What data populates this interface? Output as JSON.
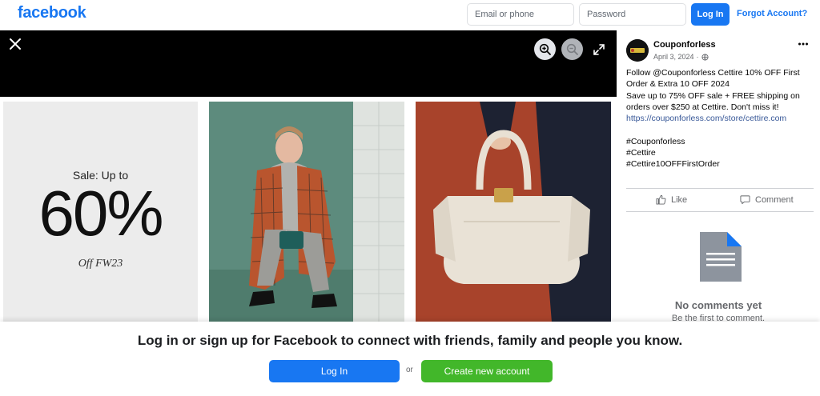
{
  "header": {
    "logo": "facebook",
    "email_placeholder": "Email or phone",
    "password_placeholder": "Password",
    "login_label": "Log In",
    "forgot_label": "Forgot Account?"
  },
  "viewer": {
    "close_icon": "close-icon",
    "zoom_in_icon": "zoom-in-icon",
    "zoom_out_icon": "zoom-out-icon",
    "fullscreen_icon": "fullscreen-icon",
    "tiles": [
      {
        "sale_label": "Sale: Up to",
        "sale_value": "60%",
        "sale_sub": "Off FW23"
      },
      {
        "image": "model-in-checked-coat"
      },
      {
        "image": "beige-handbag"
      }
    ]
  },
  "post": {
    "page_name": "Couponforless",
    "date": "April 3, 2024",
    "date_separator": "·",
    "globe_icon": "globe-icon",
    "more_icon": "more-icon",
    "text_lines": [
      "Follow @Couponforless Cettire 10% OFF First",
      "Order & Extra 10 OFF 2024",
      "Save up to 75% OFF sale + FREE shipping on",
      "orders over $250 at Cettire. Don't miss it!"
    ],
    "link": "https://couponforless.com/store/cettire.com",
    "hashtags": [
      "#Couponforless",
      "#Cettire",
      "#Cettire10OFFFirstOrder"
    ],
    "like_label": "Like",
    "comment_label": "Comment",
    "no_comments": "No comments yet",
    "be_first": "Be the first to comment."
  },
  "login_prompt": {
    "title": "Log in or sign up for Facebook to connect with friends, family and people you know.",
    "login_label": "Log In",
    "or_label": "or",
    "create_label": "Create new account"
  },
  "colors": {
    "brand_blue": "#1877f2",
    "green": "#42b72a",
    "link": "#385898",
    "muted": "#65676b"
  }
}
